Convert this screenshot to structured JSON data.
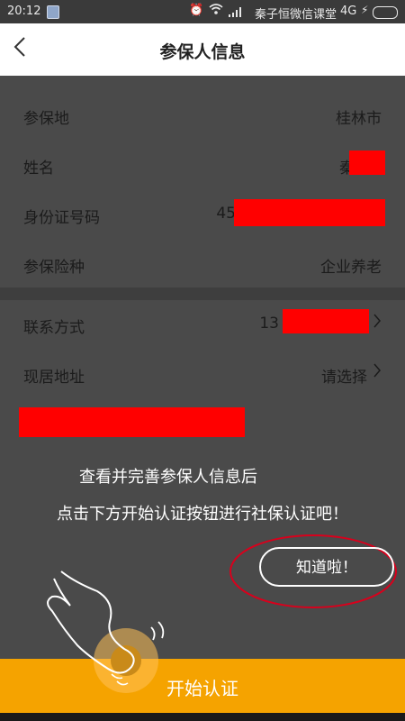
{
  "status_bar": {
    "time": "20:12",
    "carrier": "秦子恒微信课堂",
    "network": "4G"
  },
  "nav": {
    "title": "参保人信息",
    "back_icon": "chevron-left-icon"
  },
  "info_rows": [
    {
      "label": "参保地",
      "value": "桂林市"
    },
    {
      "label": "姓名",
      "value": "秦"
    },
    {
      "label": "身份证号码",
      "value": "45"
    },
    {
      "label": "参保险种",
      "value": "企业养老"
    }
  ],
  "contact_rows": [
    {
      "label": "联系方式",
      "value": "13"
    },
    {
      "label": "现居地址",
      "value": "请选择"
    }
  ],
  "guide": {
    "line1": "查看并完善参保人信息后",
    "line2": "点击下方开始认证按钮进行社保认证吧！",
    "got_it": "知道啦！"
  },
  "start_button": {
    "label": "开始认证"
  },
  "colors": {
    "accent": "#f5a300",
    "redaction": "#ff0000",
    "overlay": "#4a4a4a"
  }
}
